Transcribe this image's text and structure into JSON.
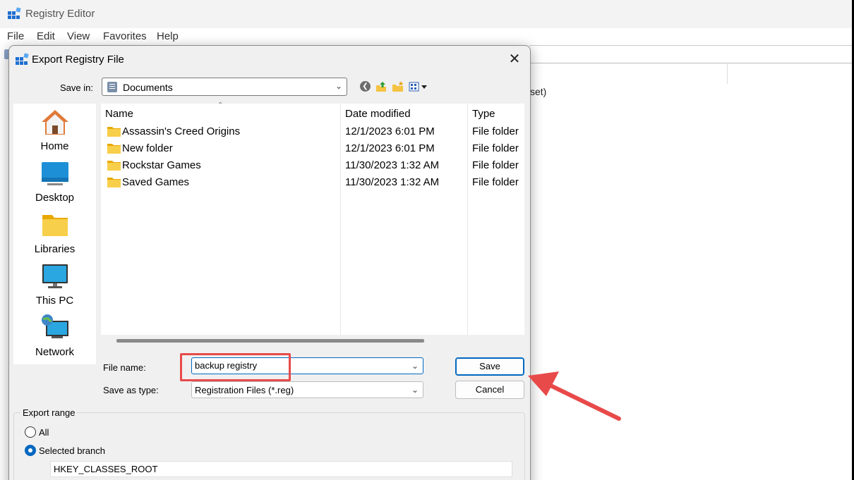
{
  "registry_editor": {
    "title": "Registry Editor",
    "menu": [
      "File",
      "Edit",
      "View",
      "Favorites",
      "Help"
    ],
    "partial_text": "set)"
  },
  "dialog": {
    "title": "Export Registry File",
    "close_symbol": "✕",
    "save_in_label": "Save in:",
    "save_in_value": "Documents",
    "places": [
      {
        "label": "Home",
        "icon": "home-icon"
      },
      {
        "label": "Desktop",
        "icon": "desktop-icon"
      },
      {
        "label": "Libraries",
        "icon": "libraries-icon"
      },
      {
        "label": "This PC",
        "icon": "this-pc-icon"
      },
      {
        "label": "Network",
        "icon": "network-icon"
      }
    ],
    "columns": [
      "Name",
      "Date modified",
      "Type"
    ],
    "files": [
      {
        "name": "Assassin's Creed Origins",
        "date": "12/1/2023 6:01 PM",
        "type": "File folder"
      },
      {
        "name": "New folder",
        "date": "12/1/2023 6:01 PM",
        "type": "File folder"
      },
      {
        "name": "Rockstar Games",
        "date": "11/30/2023 1:32 AM",
        "type": "File folder"
      },
      {
        "name": "Saved Games",
        "date": "11/30/2023 1:32 AM",
        "type": "File folder"
      }
    ],
    "file_name_label": "File name:",
    "file_name_value": "backup registry",
    "save_as_type_label": "Save as type:",
    "save_as_type_value": "Registration Files (*.reg)",
    "save_button": "Save",
    "cancel_button": "Cancel",
    "export_range": {
      "legend": "Export range",
      "all_label": "All",
      "selected_branch_label": "Selected branch",
      "selected": "Selected branch",
      "branch_value": "HKEY_CLASSES_ROOT"
    }
  },
  "colors": {
    "accent": "#0067c0",
    "annotation_red": "#e84a4a",
    "folder_yellow": "#f5c242"
  }
}
